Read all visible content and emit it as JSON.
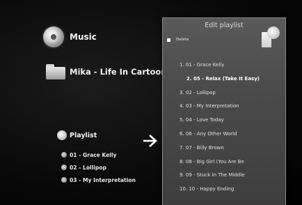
{
  "music": {
    "label": "Music"
  },
  "album": {
    "label": "Mika - Life In Cartoon Moti"
  },
  "playlist": {
    "label": "Playlist",
    "items": [
      {
        "label": "01 - Grace Kelly"
      },
      {
        "label": "02 - Lollipop"
      },
      {
        "label": "03 - My Interpretation"
      }
    ]
  },
  "edit_panel": {
    "title": "Edit playlist",
    "delete_label": "Delete",
    "tracks": [
      {
        "label": "1. 01 - Grace Kelly"
      },
      {
        "label": "2. 05 - Relax (Take It Easy)"
      },
      {
        "label": "3. 02 - Lollipop"
      },
      {
        "label": "4. 03 - My Interpretation"
      },
      {
        "label": "5. 04 - Love Today"
      },
      {
        "label": "6. 06 - Any Other World"
      },
      {
        "label": "7. 07 - Billy Brown"
      },
      {
        "label": "8. 08 - Big Girl (You Are Be"
      },
      {
        "label": "9. 09 - Stuck In The Middle"
      },
      {
        "label": "10. 10 - Happy Ending"
      }
    ],
    "selected_index": 1
  },
  "icons": {
    "music": "disc-icon",
    "album": "folder-icon",
    "playlist": "playlist-icon",
    "arrow": "arrow-right-icon",
    "panel": "playlist-edit-icon"
  }
}
